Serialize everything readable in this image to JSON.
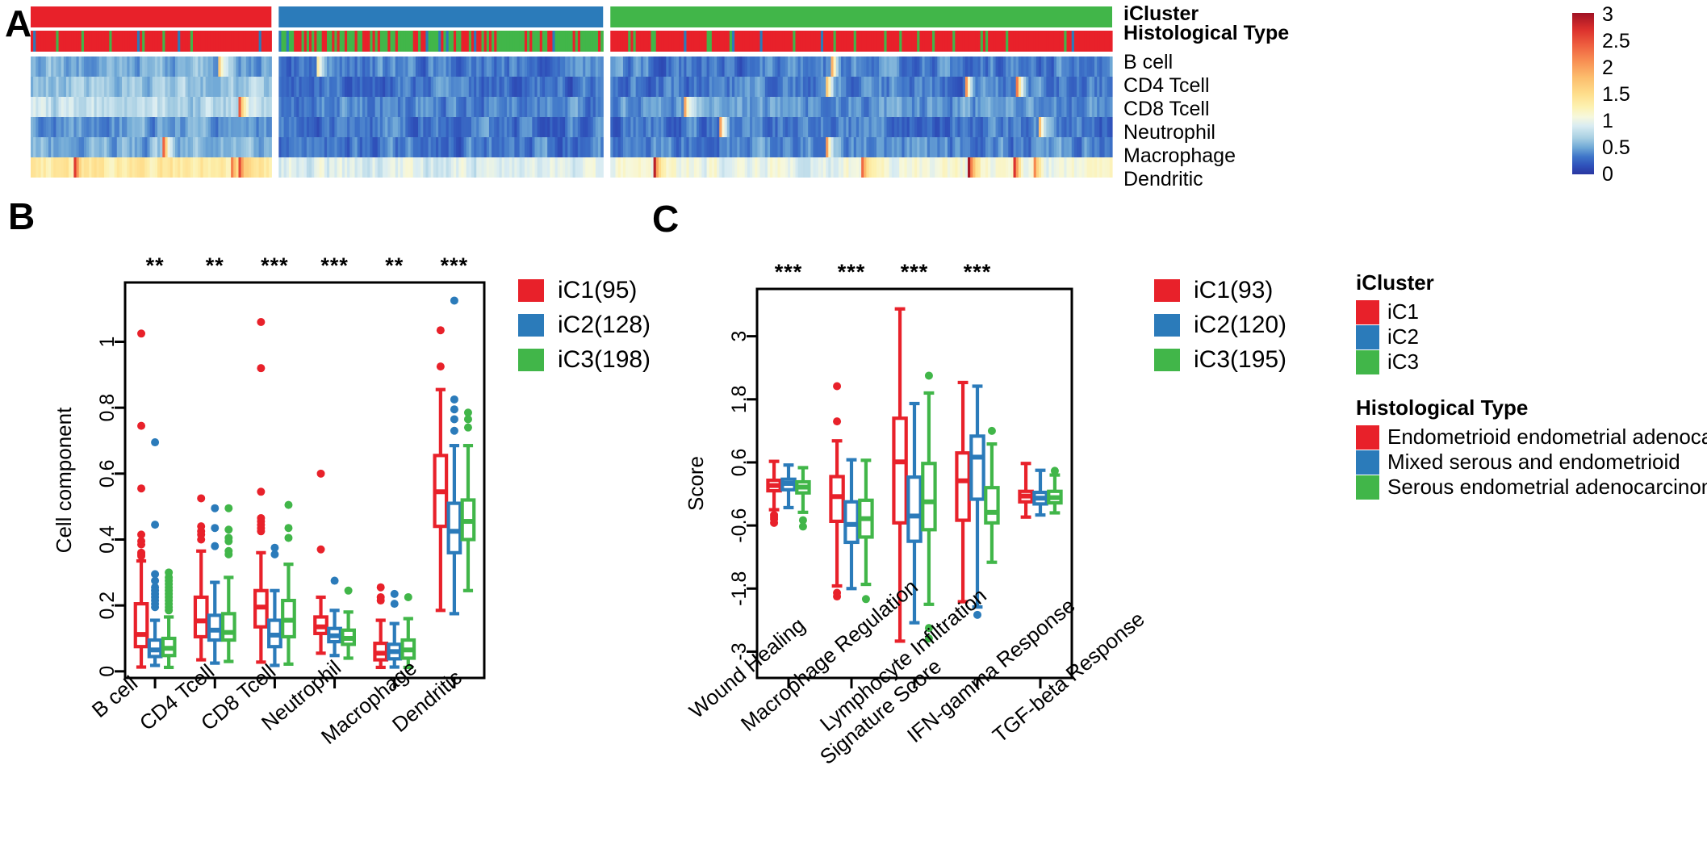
{
  "panels": {
    "a": {
      "letter": "A"
    },
    "b": {
      "letter": "B"
    },
    "c": {
      "letter": "C"
    }
  },
  "heatmap": {
    "annotation_rows": [
      {
        "name": "iCluster",
        "label": "iCluster"
      },
      {
        "name": "Histological Type",
        "label": "Histological Type"
      }
    ],
    "row_labels": [
      "B cell",
      "CD4 Tcell",
      "CD8 Tcell",
      "Neutrophil",
      "Macrophage",
      "Dendritic"
    ],
    "colorbar": {
      "ticks": [
        "3",
        "2.5",
        "2",
        "1.5",
        "1",
        "0.5",
        "0"
      ],
      "min": 0,
      "max": 3
    },
    "cluster_blocks": [
      {
        "cluster": "iC1",
        "color": "#e8212a",
        "n": 95
      },
      {
        "cluster": "iC2",
        "color": "#2b7bba",
        "n": 128
      },
      {
        "cluster": "iC3",
        "color": "#41b649",
        "n": 198
      }
    ]
  },
  "chart_data": [
    {
      "type": "box",
      "panel": "B",
      "title": "",
      "ylabel": "Cell component",
      "xlabel": "",
      "ylim": [
        -0.02,
        1.18
      ],
      "yticks": [
        "0",
        "0.2",
        "0.4",
        "0.6",
        "0.8",
        "1"
      ],
      "ytickvals": [
        0,
        0.2,
        0.4,
        0.6,
        0.8,
        1
      ],
      "categories": [
        "B cell",
        "CD4 Tcell",
        "CD8 Tcell",
        "Neutrophil",
        "Macrophage",
        "Dendritic"
      ],
      "significance": [
        "**",
        "**",
        "***",
        "***",
        "**",
        "***"
      ],
      "legend": {
        "position": "right",
        "entries": [
          {
            "label": "iC1(95)",
            "color": "#e8212a"
          },
          {
            "label": "iC2(128)",
            "color": "#2b7bba"
          },
          {
            "label": "iC3(198)",
            "color": "#41b649"
          }
        ]
      },
      "series": [
        {
          "name": "iC1(95)",
          "color": "#e8212a",
          "boxes": [
            {
              "cat": "B cell",
              "low": 0.013,
              "q1": 0.075,
              "med": 0.112,
              "q3": 0.205,
              "high": 0.335,
              "outliers": [
                1.025,
                0.745,
                0.555,
                0.415,
                0.395,
                0.385,
                0.36,
                0.355,
                0.35
              ]
            },
            {
              "cat": "CD4 Tcell",
              "low": 0.035,
              "q1": 0.105,
              "med": 0.153,
              "q3": 0.225,
              "high": 0.365,
              "outliers": [
                0.525,
                0.44,
                0.425,
                0.415,
                0.4
              ]
            },
            {
              "cat": "CD8 Tcell",
              "low": 0.028,
              "q1": 0.135,
              "med": 0.195,
              "q3": 0.245,
              "high": 0.36,
              "outliers": [
                1.06,
                0.92,
                0.545,
                0.465,
                0.455,
                0.445,
                0.435,
                0.425
              ]
            },
            {
              "cat": "Neutrophil",
              "low": 0.055,
              "q1": 0.115,
              "med": 0.135,
              "q3": 0.165,
              "high": 0.225,
              "outliers": [
                0.6,
                0.37
              ]
            },
            {
              "cat": "Macrophage",
              "low": 0.012,
              "q1": 0.035,
              "med": 0.055,
              "q3": 0.085,
              "high": 0.155,
              "outliers": [
                0.255,
                0.225,
                0.215
              ]
            },
            {
              "cat": "Dendritic",
              "low": 0.185,
              "q1": 0.44,
              "med": 0.545,
              "q3": 0.655,
              "high": 0.855,
              "outliers": [
                1.035,
                0.925
              ]
            }
          ]
        },
        {
          "name": "iC2(128)",
          "color": "#2b7bba",
          "boxes": [
            {
              "cat": "B cell",
              "low": 0.018,
              "q1": 0.045,
              "med": 0.065,
              "q3": 0.095,
              "high": 0.155,
              "outliers": [
                0.695,
                0.445,
                0.295,
                0.275,
                0.255,
                0.245,
                0.235,
                0.225,
                0.215,
                0.205,
                0.195
              ]
            },
            {
              "cat": "CD4 Tcell",
              "low": 0.025,
              "q1": 0.095,
              "med": 0.125,
              "q3": 0.17,
              "high": 0.27,
              "outliers": [
                0.495,
                0.435,
                0.38
              ]
            },
            {
              "cat": "CD8 Tcell",
              "low": 0.018,
              "q1": 0.075,
              "med": 0.11,
              "q3": 0.155,
              "high": 0.245,
              "outliers": [
                0.375,
                0.355
              ]
            },
            {
              "cat": "Neutrophil",
              "low": 0.048,
              "q1": 0.09,
              "med": 0.108,
              "q3": 0.13,
              "high": 0.185,
              "outliers": [
                0.275
              ]
            },
            {
              "cat": "Macrophage",
              "low": 0.013,
              "q1": 0.038,
              "med": 0.06,
              "q3": 0.082,
              "high": 0.145,
              "outliers": [
                0.235,
                0.205
              ]
            },
            {
              "cat": "Dendritic",
              "low": 0.175,
              "q1": 0.36,
              "med": 0.425,
              "q3": 0.51,
              "high": 0.685,
              "outliers": [
                1.125,
                0.825,
                0.795,
                0.765,
                0.73
              ]
            }
          ]
        },
        {
          "name": "iC3(198)",
          "color": "#41b649",
          "boxes": [
            {
              "cat": "B cell",
              "low": 0.012,
              "q1": 0.048,
              "med": 0.07,
              "q3": 0.1,
              "high": 0.165,
              "outliers": [
                0.3,
                0.285,
                0.275,
                0.265,
                0.255,
                0.245,
                0.235,
                0.225,
                0.215,
                0.205,
                0.195,
                0.185
              ]
            },
            {
              "cat": "CD4 Tcell",
              "low": 0.03,
              "q1": 0.095,
              "med": 0.118,
              "q3": 0.175,
              "high": 0.285,
              "outliers": [
                0.495,
                0.43,
                0.405,
                0.395,
                0.365,
                0.355
              ]
            },
            {
              "cat": "CD8 Tcell",
              "low": 0.022,
              "q1": 0.105,
              "med": 0.155,
              "q3": 0.215,
              "high": 0.325,
              "outliers": [
                0.505,
                0.435,
                0.405
              ]
            },
            {
              "cat": "Neutrophil",
              "low": 0.04,
              "q1": 0.082,
              "med": 0.1,
              "q3": 0.125,
              "high": 0.18,
              "outliers": [
                0.245
              ]
            },
            {
              "cat": "Macrophage",
              "low": 0.012,
              "q1": 0.04,
              "med": 0.065,
              "q3": 0.095,
              "high": 0.16,
              "outliers": [
                0.225
              ]
            },
            {
              "cat": "Dendritic",
              "low": 0.245,
              "q1": 0.4,
              "med": 0.455,
              "q3": 0.52,
              "high": 0.685,
              "outliers": [
                0.785,
                0.765,
                0.74
              ]
            }
          ]
        }
      ]
    },
    {
      "type": "box",
      "panel": "C",
      "title": "",
      "ylabel": "Score",
      "xlabel": "",
      "ylim": [
        -3.5,
        3.9
      ],
      "yticks": [
        "3",
        "1.8",
        "0.6",
        "-0.6",
        "-1.8",
        "-3"
      ],
      "ytickvals": [
        3,
        1.8,
        0.6,
        -0.6,
        -1.8,
        -3
      ],
      "categories": [
        "Wound Healing",
        "Macrophage Regulation",
        "Lymphocyte Infiltration Signature Score",
        "IFN-gamma Response",
        "TGF-beta Response"
      ],
      "category_labels": [
        "Wound Healing",
        "Macrophage Regulation",
        "Lymphocyte Infiltration",
        "Signature Score",
        "IFN-gamma Response",
        "TGF-beta Response"
      ],
      "significance": [
        "***",
        "***",
        "***",
        "***"
      ],
      "legend": {
        "position": "right",
        "entries": [
          {
            "label": "iC1(93)",
            "color": "#e8212a"
          },
          {
            "label": "iC2(120)",
            "color": "#2b7bba"
          },
          {
            "label": "iC3(195)",
            "color": "#41b649"
          }
        ]
      },
      "series": [
        {
          "name": "iC1(93)",
          "color": "#e8212a",
          "boxes": [
            {
              "cat": "Wound Healing",
              "low": -0.3,
              "q1": 0.06,
              "med": 0.16,
              "q3": 0.26,
              "high": 0.62,
              "outliers": [
                -0.4,
                -0.44,
                -0.48,
                -0.55
              ]
            },
            {
              "cat": "Macrophage Regulation",
              "low": -1.75,
              "q1": -0.52,
              "med": -0.05,
              "q3": 0.33,
              "high": 1.01,
              "outliers": [
                2.05,
                1.38,
                -1.88,
                -1.95
              ]
            },
            {
              "cat": "Lymphocyte Infiltration",
              "low": -2.8,
              "q1": -0.55,
              "med": 0.61,
              "q3": 1.44,
              "high": 3.52,
              "outliers": []
            },
            {
              "cat": "IFN-gamma Response",
              "low": -2.05,
              "q1": -0.5,
              "med": 0.25,
              "q3": 0.78,
              "high": 2.12,
              "outliers": []
            },
            {
              "cat": "TGF-beta Response",
              "low": -0.44,
              "q1": -0.15,
              "med": -0.04,
              "q3": 0.05,
              "high": 0.58,
              "outliers": []
            }
          ]
        },
        {
          "name": "iC2(120)",
          "color": "#2b7bba",
          "boxes": [
            {
              "cat": "Wound Healing",
              "low": -0.26,
              "q1": 0.08,
              "med": 0.2,
              "q3": 0.28,
              "high": 0.55,
              "outliers": []
            },
            {
              "cat": "Macrophage Regulation",
              "low": -1.8,
              "q1": -0.92,
              "med": -0.58,
              "q3": -0.15,
              "high": 0.65,
              "outliers": []
            },
            {
              "cat": "Lymphocyte Infiltration",
              "low": -2.45,
              "q1": -0.9,
              "med": -0.42,
              "q3": 0.32,
              "high": 1.72,
              "outliers": []
            },
            {
              "cat": "IFN-gamma Response",
              "low": -2.15,
              "q1": -0.1,
              "med": 0.7,
              "q3": 1.1,
              "high": 2.05,
              "outliers": [
                -2.3
              ]
            },
            {
              "cat": "TGF-beta Response",
              "low": -0.4,
              "q1": -0.19,
              "med": -0.08,
              "q3": 0.03,
              "high": 0.45,
              "outliers": []
            }
          ]
        },
        {
          "name": "iC3(195)",
          "color": "#41b649",
          "boxes": [
            {
              "cat": "Wound Healing",
              "low": -0.35,
              "q1": 0.02,
              "med": 0.13,
              "q3": 0.23,
              "high": 0.5,
              "outliers": [
                -0.5,
                -0.62
              ]
            },
            {
              "cat": "Macrophage Regulation",
              "low": -1.72,
              "q1": -0.82,
              "med": -0.47,
              "q3": -0.12,
              "high": 0.64,
              "outliers": [
                -2.0
              ]
            },
            {
              "cat": "Lymphocyte Infiltration",
              "low": -2.1,
              "q1": -0.68,
              "med": -0.15,
              "q3": 0.58,
              "high": 1.92,
              "outliers": [
                2.25,
                -2.55,
                -2.75
              ]
            },
            {
              "cat": "IFN-gamma Response",
              "low": -1.3,
              "q1": -0.55,
              "med": -0.35,
              "q3": 0.12,
              "high": 0.95,
              "outliers": [
                1.2
              ]
            },
            {
              "cat": "TGF-beta Response",
              "low": -0.36,
              "q1": -0.17,
              "med": -0.07,
              "q3": 0.05,
              "high": 0.36,
              "outliers": [
                0.44
              ]
            }
          ]
        }
      ]
    }
  ],
  "side_legend": {
    "icluster": {
      "title": "iCluster",
      "entries": [
        {
          "label": "iC1",
          "color": "#e8212a"
        },
        {
          "label": "iC2",
          "color": "#2b7bba"
        },
        {
          "label": "iC3",
          "color": "#41b649"
        }
      ]
    },
    "histological": {
      "title": "Histological Type",
      "entries": [
        {
          "label": "Endometrioid endometrial adenocarcinoma",
          "color": "#e8212a"
        },
        {
          "label": "Mixed serous and endometrioid",
          "color": "#2b7bba"
        },
        {
          "label": "Serous endometrial adenocarcinoma",
          "color": "#41b649"
        }
      ]
    }
  },
  "colors": {
    "red": "#e8212a",
    "blue": "#2b7bba",
    "green": "#41b649",
    "black": "#000000"
  }
}
